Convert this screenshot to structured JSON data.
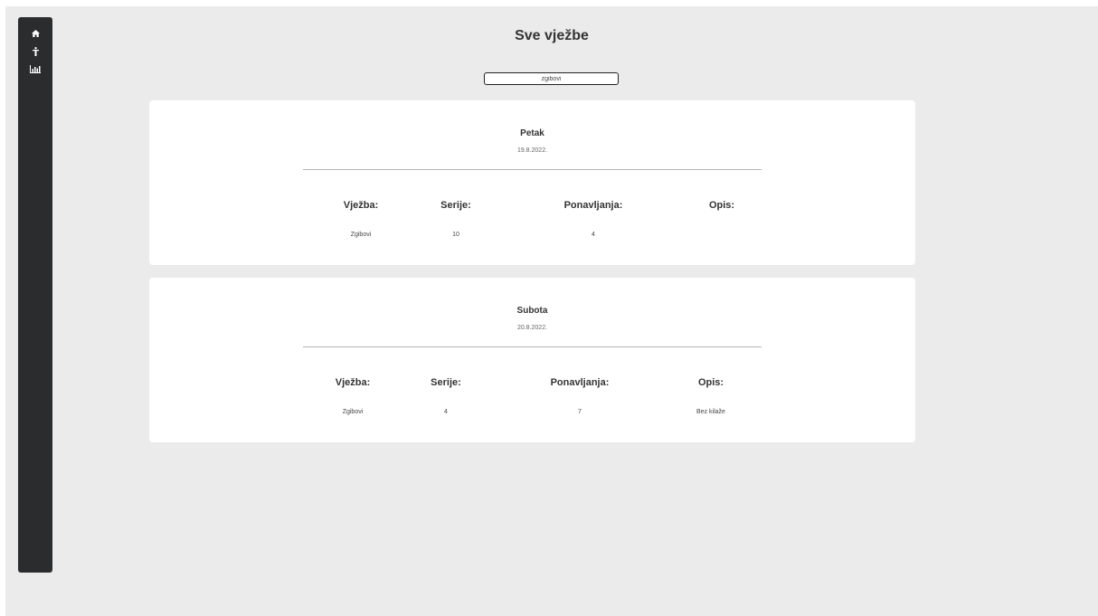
{
  "page": {
    "title": "Sve vježbe"
  },
  "sidebar": {
    "items": [
      {
        "icon": "home-icon"
      },
      {
        "icon": "workout-icon"
      },
      {
        "icon": "bar-chart-icon"
      }
    ]
  },
  "search": {
    "value": "zgibovi"
  },
  "workouts": [
    {
      "day": "Petak",
      "date": "19.8.2022.",
      "headers": [
        "Vježba:",
        "Serije:",
        "Ponavljanja:",
        "Opis:"
      ],
      "rows": [
        [
          "Zgibovi",
          "10",
          "4",
          ""
        ]
      ]
    },
    {
      "day": "Subota",
      "date": "20.8.2022.",
      "headers": [
        "Vježba:",
        "Serije:",
        "Ponavljanja:",
        "Opis:"
      ],
      "rows": [
        [
          "Zgibovi",
          "4",
          "7",
          "Bez kilaže"
        ]
      ]
    }
  ],
  "colors": {
    "sidebar": "#2b2c2e",
    "background": "#ebebeb",
    "card": "#ffffff"
  }
}
